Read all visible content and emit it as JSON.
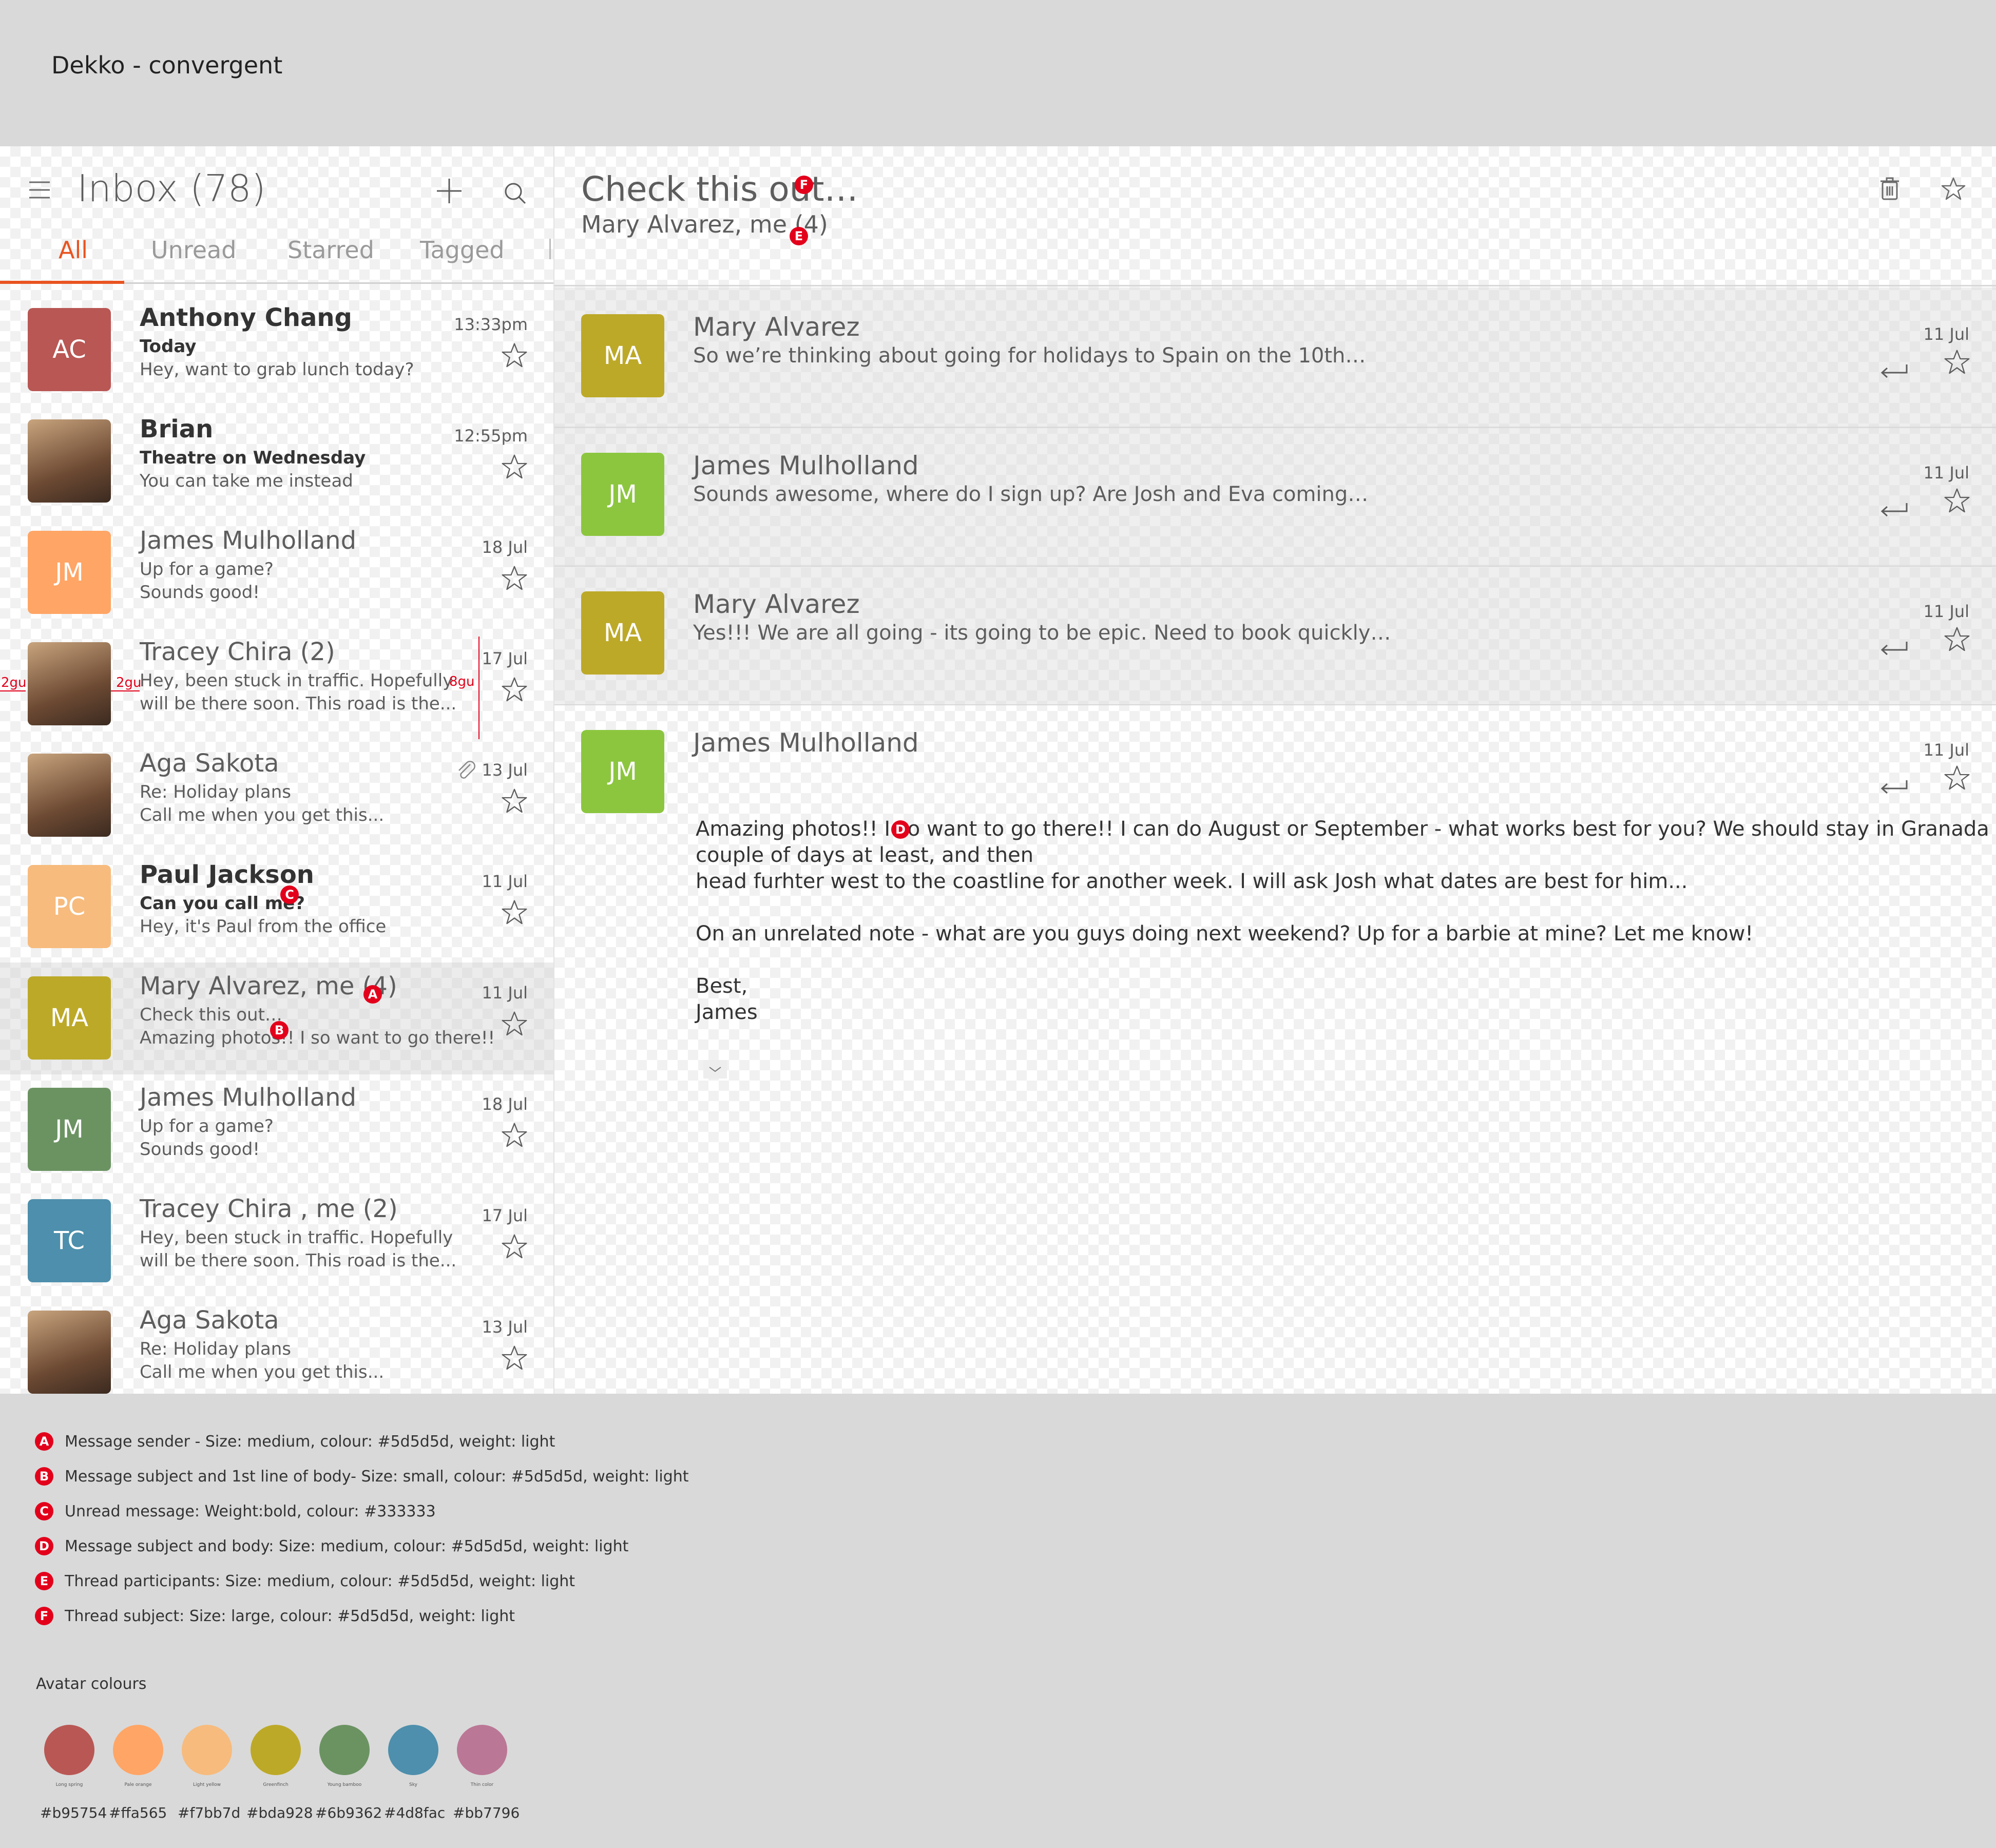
{
  "app_title": "Dekko - convergent",
  "list": {
    "title": "Inbox (78)",
    "tabs": [
      {
        "label": "All",
        "active": true
      },
      {
        "label": "Unread",
        "active": false
      },
      {
        "label": "Starred",
        "active": false
      },
      {
        "label": "Tagged",
        "active": false
      }
    ],
    "rows": [
      {
        "initials": "AC",
        "color": "#b95754",
        "sender": "Anthony Chang",
        "subject": "Today",
        "preview": "Hey, want to grab lunch today?",
        "time": "13:33pm",
        "bold": true
      },
      {
        "initials": "",
        "color": "photo",
        "sender": "Brian",
        "subject": "Theatre on Wednesday",
        "preview": "You can take me instead",
        "time": "12:55pm",
        "bold": true
      },
      {
        "initials": "JM",
        "color": "#ffa565",
        "sender": "James Mulholland",
        "subject": "Up for a game?",
        "preview": "Sounds good!",
        "time": "18 Jul",
        "bold": false
      },
      {
        "initials": "",
        "color": "photo",
        "sender": "Tracey Chira (2)",
        "subject": "Hey, been stuck in traffic. Hopefully",
        "preview": "will be there soon. This road is the...",
        "time": "17 Jul",
        "bold": false
      },
      {
        "initials": "",
        "color": "photo",
        "sender": "Aga Sakota",
        "subject": "Re: Holiday plans",
        "preview": "Call me when you get this...",
        "time": "13 Jul",
        "bold": false,
        "attachment": true
      },
      {
        "initials": "PC",
        "color": "#f7bb7d",
        "sender": "Paul Jackson",
        "subject": "Can you call me?",
        "preview": "Hey, it's Paul from the office",
        "time": "11 Jul",
        "bold": true
      },
      {
        "initials": "MA",
        "color": "#bda928",
        "sender": "Mary Alvarez, me (4)",
        "subject": "Check this out…",
        "preview": "Amazing photos!! I so want to go there!!",
        "time": "11 Jul",
        "bold": false,
        "selected": true
      },
      {
        "initials": "JM",
        "color": "#6b9362",
        "sender": "James Mulholland",
        "subject": "Up for a game?",
        "preview": "Sounds good!",
        "time": "18 Jul",
        "bold": false
      },
      {
        "initials": "TC",
        "color": "#4d8fac",
        "sender": "Tracey Chira , me (2)",
        "subject": "Hey, been stuck in traffic. Hopefully",
        "preview": "will be there soon. This road is the...",
        "time": "17 Jul",
        "bold": false
      },
      {
        "initials": "",
        "color": "photo",
        "sender": "Aga Sakota",
        "subject": "Re: Holiday plans",
        "preview": "Call me when you get this...",
        "time": "13 Jul",
        "bold": false
      }
    ],
    "spec_labels": {
      "left": "2gu",
      "middle": "2gu",
      "right": "8gu"
    }
  },
  "thread": {
    "subject": "Check this out…",
    "participants": "Mary Alvarez, me (4)",
    "messages": [
      {
        "initials": "MA",
        "color": "#bda928",
        "sender": "Mary Alvarez",
        "preview": "So we’re thinking about going for holidays to Spain on the 10th…",
        "date": "11 Jul"
      },
      {
        "initials": "JM",
        "color": "#8cc63f",
        "sender": "James Mulholland",
        "preview": "Sounds awesome, where do I sign up? Are Josh and Eva coming…",
        "date": "11 Jul"
      },
      {
        "initials": "MA",
        "color": "#bda928",
        "sender": "Mary Alvarez",
        "preview": "Yes!!! We are all going - its going to be epic. Need to book quickly…",
        "date": "11 Jul"
      },
      {
        "initials": "JM",
        "color": "#8cc63f",
        "sender": "James Mulholland",
        "preview": "",
        "date": "11 Jul"
      }
    ],
    "body_lines": [
      "Amazing photos!! I so want to go there!! I can do  August or September - what works best for you? We should stay in Granada for a",
      "couple of days at least, and then",
      "head   furhter west to the coastline for another week. I will ask Josh what dates are best for him...",
      "",
      "On an unrelated note - what are you guys doing next weekend? Up for a barbie at mine? Let me know!",
      "",
      "Best,",
      "James"
    ]
  },
  "legend": [
    {
      "key": "A",
      "text": "Message sender - Size: medium, colour: #5d5d5d, weight: light"
    },
    {
      "key": "B",
      "text": "Message subject and 1st line of body- Size: small, colour: #5d5d5d, weight: light"
    },
    {
      "key": "C",
      "text": "Unread message: Weight:bold, colour: #333333"
    },
    {
      "key": "D",
      "text": "Message subject and body: Size: medium, colour: #5d5d5d, weight: light"
    },
    {
      "key": "E",
      "text": "Thread participants: Size: medium, colour: #5d5d5d, weight: light"
    },
    {
      "key": "F",
      "text": "Thread subject: Size: large, colour: #5d5d5d, weight: light"
    }
  ],
  "avatar_colours": {
    "title": "Avatar colours",
    "swatches": [
      {
        "hex": "#b95754",
        "name": "Long spring"
      },
      {
        "hex": "#ffa565",
        "name": "Pale orange"
      },
      {
        "hex": "#f7bb7d",
        "name": "Light yellow"
      },
      {
        "hex": "#bda928",
        "name": "Greenfinch"
      },
      {
        "hex": "#6b9362",
        "name": "Young bamboo"
      },
      {
        "hex": "#4d8fac",
        "name": "Sky"
      },
      {
        "hex": "#bb7796",
        "name": "Thin color"
      }
    ]
  }
}
